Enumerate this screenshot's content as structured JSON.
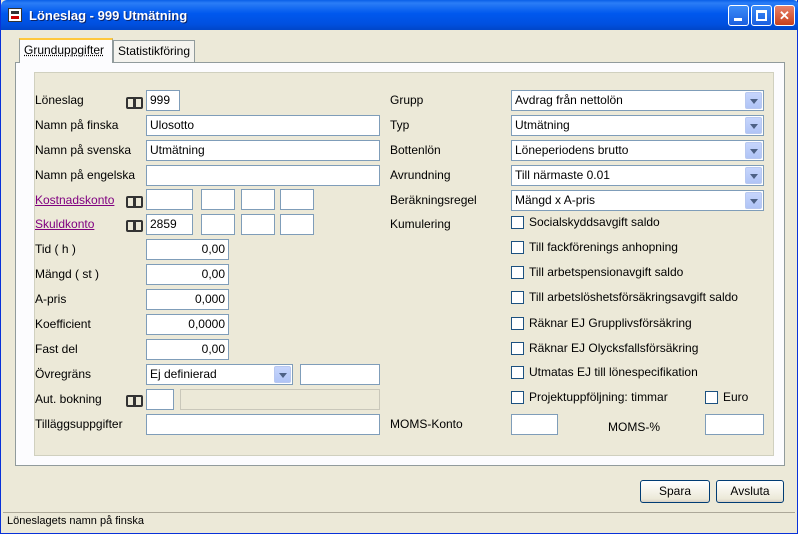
{
  "window": {
    "title": "Löneslag - 999 Utmätning"
  },
  "tabs": [
    {
      "label": "Grunduppgifter"
    },
    {
      "label": "Statistikföring"
    }
  ],
  "left": {
    "loneslag": {
      "label": "Löneslag",
      "value": "999"
    },
    "namn_finska": {
      "label": "Namn på finska",
      "value": "Ulosotto"
    },
    "namn_svenska": {
      "label": "Namn på svenska",
      "value": "Utmätning"
    },
    "namn_engelska": {
      "label": "Namn på engelska",
      "value": ""
    },
    "kostnadskonto": {
      "label": "Kostnadskonto",
      "values": [
        "",
        "",
        "",
        ""
      ]
    },
    "skuldkonto": {
      "label": "Skuldkonto",
      "values": [
        "2859",
        "",
        "",
        ""
      ]
    },
    "tid": {
      "label": "Tid ( h )",
      "value": "0,00"
    },
    "mangd": {
      "label": "Mängd ( st )",
      "value": "0,00"
    },
    "apris": {
      "label": "A-pris",
      "value": "0,000"
    },
    "koefficient": {
      "label": "Koefficient",
      "value": "0,0000"
    },
    "fast_del": {
      "label": "Fast del",
      "value": "0,00"
    },
    "overgrans": {
      "label": "Övregräns",
      "value": "Ej definierad",
      "extra": ""
    },
    "aut_bokning": {
      "label": "Aut. bokning",
      "value": "",
      "extra": ""
    },
    "tillaggsuppgifter": {
      "label": "Tilläggsuppgifter",
      "value": ""
    }
  },
  "right": {
    "grupp": {
      "label": "Grupp",
      "value": "Avdrag från nettolön"
    },
    "typ": {
      "label": "Typ",
      "value": "Utmätning"
    },
    "bottenlon": {
      "label": "Bottenlön",
      "value": "Löneperiodens brutto"
    },
    "avrundning": {
      "label": "Avrundning",
      "value": "Till närmaste 0.01"
    },
    "berakningsregel": {
      "label": "Beräkningsregel",
      "value": "Mängd x A-pris"
    },
    "kumulering": {
      "label": "Kumulering"
    },
    "checkboxes": [
      {
        "label": "Socialskyddsavgift saldo",
        "checked": false
      },
      {
        "label": "Till fackförenings anhopning",
        "checked": false
      },
      {
        "label": "Till arbetspensionavgift saldo",
        "checked": false
      },
      {
        "label": "Till arbetslöshetsförsäkringsavgift saldo",
        "checked": false
      },
      {
        "label": "Räknar EJ Grupplivsförsäkring",
        "checked": false
      },
      {
        "label": "Räknar EJ Olycksfallsförsäkring",
        "checked": false
      },
      {
        "label": "Utmatas EJ till lönespecifikation",
        "checked": false
      },
      {
        "label": "Projektuppföljning: timmar",
        "checked": false
      }
    ],
    "euro": {
      "label": "Euro",
      "checked": false
    },
    "moms_konto": {
      "label": "MOMS-Konto",
      "value": ""
    },
    "moms_procent": {
      "label": "MOMS-%",
      "value": ""
    }
  },
  "buttons": {
    "spara": "Spara",
    "avsluta": "Avsluta"
  },
  "status": {
    "text": "Löneslagets namn på finska"
  }
}
